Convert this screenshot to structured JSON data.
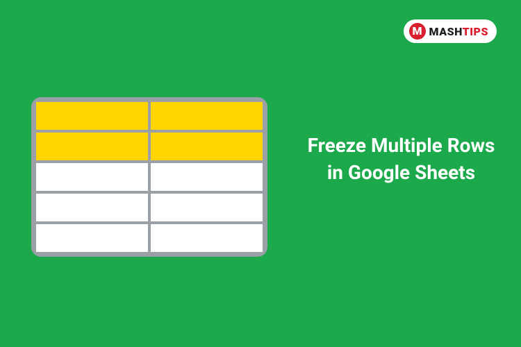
{
  "logo": {
    "mark_letter": "M",
    "brand_prefix": "MASH",
    "brand_suffix": "TIPS"
  },
  "title_text": "Freeze Multiple Rows in Google Sheets",
  "sheet": {
    "rows": 5,
    "cols": 2,
    "frozen_rows": 2
  },
  "colors": {
    "background": "#1ba94c",
    "frozen_cell": "#ffd600",
    "normal_cell": "#ffffff",
    "sheet_border": "#9aa0a6",
    "accent": "#d91e2e"
  }
}
